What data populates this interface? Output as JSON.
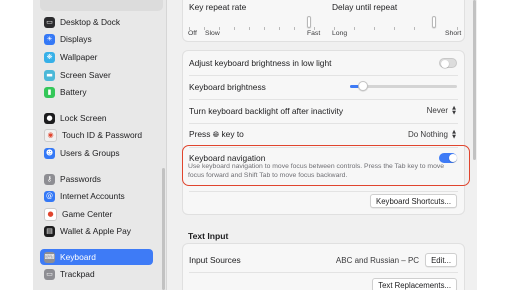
{
  "sidebar": {
    "items": [
      {
        "label": "Desktop & Dock",
        "icon": "desktop-dock-icon",
        "color": "#2b2b2e",
        "glyph": "▭",
        "selected": false
      },
      {
        "label": "Displays",
        "icon": "displays-icon",
        "color": "#3478f6",
        "glyph": "☀",
        "selected": false
      },
      {
        "label": "Wallpaper",
        "icon": "wallpaper-icon",
        "color": "#36b0e8",
        "glyph": "❋",
        "selected": false
      },
      {
        "label": "Screen Saver",
        "icon": "screen-saver-icon",
        "color": "#4bb8d8",
        "glyph": "▬",
        "selected": false
      },
      {
        "label": "Battery",
        "icon": "battery-icon",
        "color": "#34c759",
        "glyph": "▮",
        "selected": false
      },
      {
        "label": "Lock Screen",
        "icon": "lock-screen-icon",
        "color": "#1c1c1e",
        "glyph": "●",
        "selected": false
      },
      {
        "label": "Touch ID & Password",
        "icon": "touch-id-icon",
        "color": "#f0f0f0",
        "glyph": "◉",
        "selected": false
      },
      {
        "label": "Users & Groups",
        "icon": "users-groups-icon",
        "color": "#3478f6",
        "glyph": "☻",
        "selected": false
      },
      {
        "label": "Passwords",
        "icon": "passwords-icon",
        "color": "#8e8e93",
        "glyph": "⚷",
        "selected": false
      },
      {
        "label": "Internet Accounts",
        "icon": "internet-accounts-icon",
        "color": "#3478f6",
        "glyph": "@",
        "selected": false
      },
      {
        "label": "Game Center",
        "icon": "game-center-icon",
        "color": "#ffffff",
        "glyph": "●",
        "selected": false
      },
      {
        "label": "Wallet & Apple Pay",
        "icon": "wallet-icon",
        "color": "#1c1c1e",
        "glyph": "▤",
        "selected": false
      },
      {
        "label": "Keyboard",
        "icon": "keyboard-icon",
        "color": "#8e8e93",
        "glyph": "⌨",
        "selected": true
      },
      {
        "label": "Trackpad",
        "icon": "trackpad-icon",
        "color": "#8e8e93",
        "glyph": "▭",
        "selected": false
      }
    ]
  },
  "keyboard": {
    "key_repeat_rate_label": "Key repeat rate",
    "key_repeat_labels": [
      "Off",
      "Slow",
      "Fast"
    ],
    "delay_until_repeat_label": "Delay until repeat",
    "delay_labels": [
      "Long",
      "Short"
    ],
    "adjust_brightness_label": "Adjust keyboard brightness in low light",
    "adjust_brightness_on": false,
    "keyboard_brightness_label": "Keyboard brightness",
    "keyboard_brightness_level": 0.08,
    "backlight_off_label": "Turn keyboard backlight off after inactivity",
    "backlight_off_value": "Never",
    "press_key_label_pre": "Press",
    "press_key_label_post": "key to",
    "press_key_value": "Do Nothing",
    "keyboard_navigation_label": "Keyboard navigation",
    "keyboard_navigation_desc": "Use keyboard navigation to move focus between controls. Press the Tab key to move focus forward and Shift Tab to move focus backward.",
    "keyboard_navigation_on": true,
    "shortcuts_button": "Keyboard Shortcuts..."
  },
  "text_input": {
    "title": "Text Input",
    "input_sources_label": "Input Sources",
    "input_sources_value": "ABC and Russian – PC",
    "edit_button": "Edit...",
    "text_replacements_button": "Text Replacements..."
  },
  "colors": {
    "accent": "#3e7bf6",
    "highlight": "#e0452e"
  }
}
